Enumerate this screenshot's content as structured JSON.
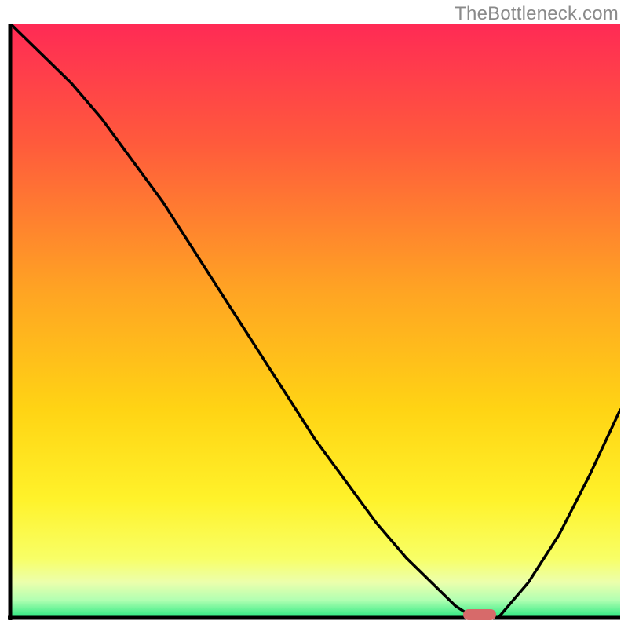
{
  "watermark": "TheBottleneck.com",
  "chart_data": {
    "type": "line",
    "title": "",
    "xlabel": "",
    "ylabel": "",
    "xlim": [
      0,
      100
    ],
    "ylim": [
      0,
      100
    ],
    "grid": false,
    "legend_position": "bottom",
    "series": [
      {
        "name": "curve",
        "x": [
          0,
          5,
          10,
          15,
          20,
          25,
          30,
          35,
          40,
          45,
          50,
          55,
          60,
          65,
          70,
          73,
          76,
          80,
          85,
          90,
          95,
          100
        ],
        "y": [
          100,
          95,
          90,
          84,
          77,
          70,
          62,
          54,
          46,
          38,
          30,
          23,
          16,
          10,
          5,
          2,
          0,
          0,
          6,
          14,
          24,
          35
        ]
      }
    ],
    "marker": {
      "x": 77,
      "y": 0
    },
    "gradient_stops": [
      {
        "offset": 0.0,
        "color": "#ff2a55"
      },
      {
        "offset": 0.2,
        "color": "#ff5a3c"
      },
      {
        "offset": 0.45,
        "color": "#ffa423"
      },
      {
        "offset": 0.65,
        "color": "#ffd414"
      },
      {
        "offset": 0.8,
        "color": "#fff22a"
      },
      {
        "offset": 0.9,
        "color": "#f8ff66"
      },
      {
        "offset": 0.94,
        "color": "#ecffac"
      },
      {
        "offset": 0.97,
        "color": "#b2ffb2"
      },
      {
        "offset": 1.0,
        "color": "#27e880"
      }
    ],
    "axes_color": "#000000",
    "line_color": "#000000"
  }
}
